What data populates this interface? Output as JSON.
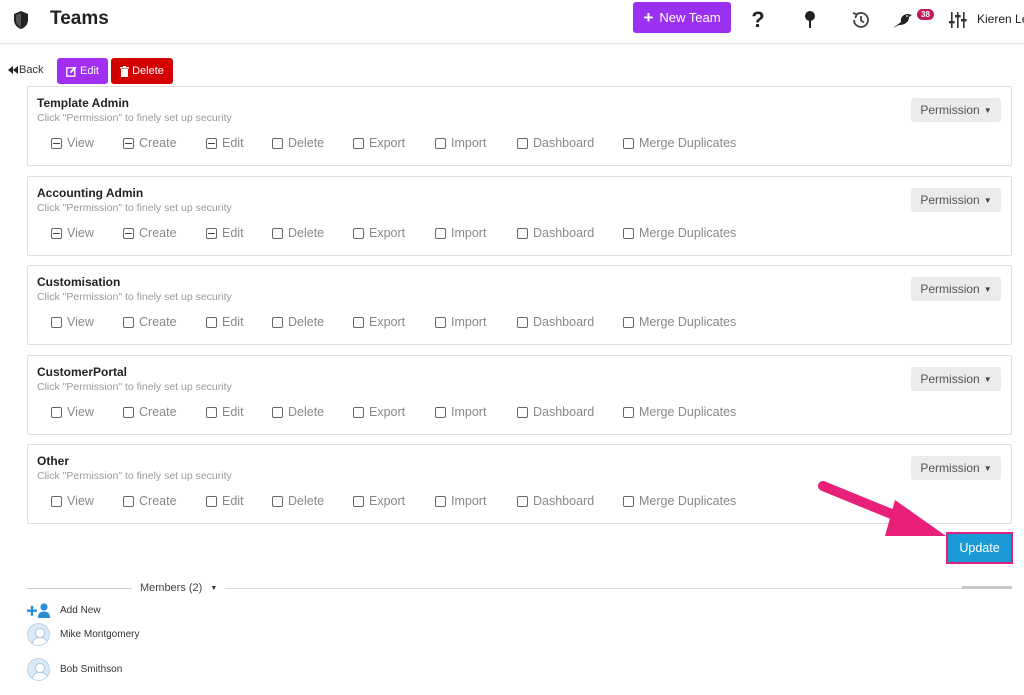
{
  "header": {
    "title": "Teams",
    "new_team_label": "New Team",
    "notification_count": "38",
    "user_name": "Kieren Le"
  },
  "actions": {
    "back_label": "Back",
    "edit_label": "Edit",
    "delete_label": "Delete"
  },
  "permission_hint": "Click \"Permission\" to finely set up security",
  "permission_button_label": "Permission",
  "option_labels": [
    "View",
    "Create",
    "Edit",
    "Delete",
    "Export",
    "Import",
    "Dashboard",
    "Merge Duplicates"
  ],
  "sections": [
    {
      "title": "Template Admin",
      "states": [
        "partial",
        "partial",
        "partial",
        "unchecked",
        "unchecked",
        "unchecked",
        "unchecked",
        "unchecked"
      ]
    },
    {
      "title": "Accounting Admin",
      "states": [
        "partial",
        "partial",
        "partial",
        "unchecked",
        "unchecked",
        "unchecked",
        "unchecked",
        "unchecked"
      ]
    },
    {
      "title": "Customisation",
      "states": [
        "unchecked",
        "unchecked",
        "unchecked",
        "unchecked",
        "unchecked",
        "unchecked",
        "unchecked",
        "unchecked"
      ]
    },
    {
      "title": "CustomerPortal",
      "states": [
        "unchecked",
        "unchecked",
        "unchecked",
        "unchecked",
        "unchecked",
        "unchecked",
        "unchecked",
        "unchecked"
      ]
    },
    {
      "title": "Other",
      "states": [
        "unchecked",
        "unchecked",
        "unchecked",
        "unchecked",
        "unchecked",
        "unchecked",
        "unchecked",
        "unchecked"
      ]
    }
  ],
  "update_label": "Update",
  "members": {
    "label": "Members (2)",
    "add_new_label": "Add New",
    "list": [
      {
        "name": "Mike Montgomery"
      },
      {
        "name": "Bob Smithson"
      }
    ]
  },
  "colors": {
    "primary_purple": "#9b30f0",
    "delete_red": "#d40000",
    "update_blue": "#1a9ad6",
    "highlight_pink": "#e0207a"
  },
  "icons": [
    "shield-icon",
    "plus-icon",
    "question-icon",
    "pin-icon",
    "history-icon",
    "bird-icon",
    "sliders-icon",
    "back-icon",
    "edit-icon",
    "trash-icon",
    "add-user-icon",
    "avatar-icon",
    "annotation-arrow"
  ]
}
